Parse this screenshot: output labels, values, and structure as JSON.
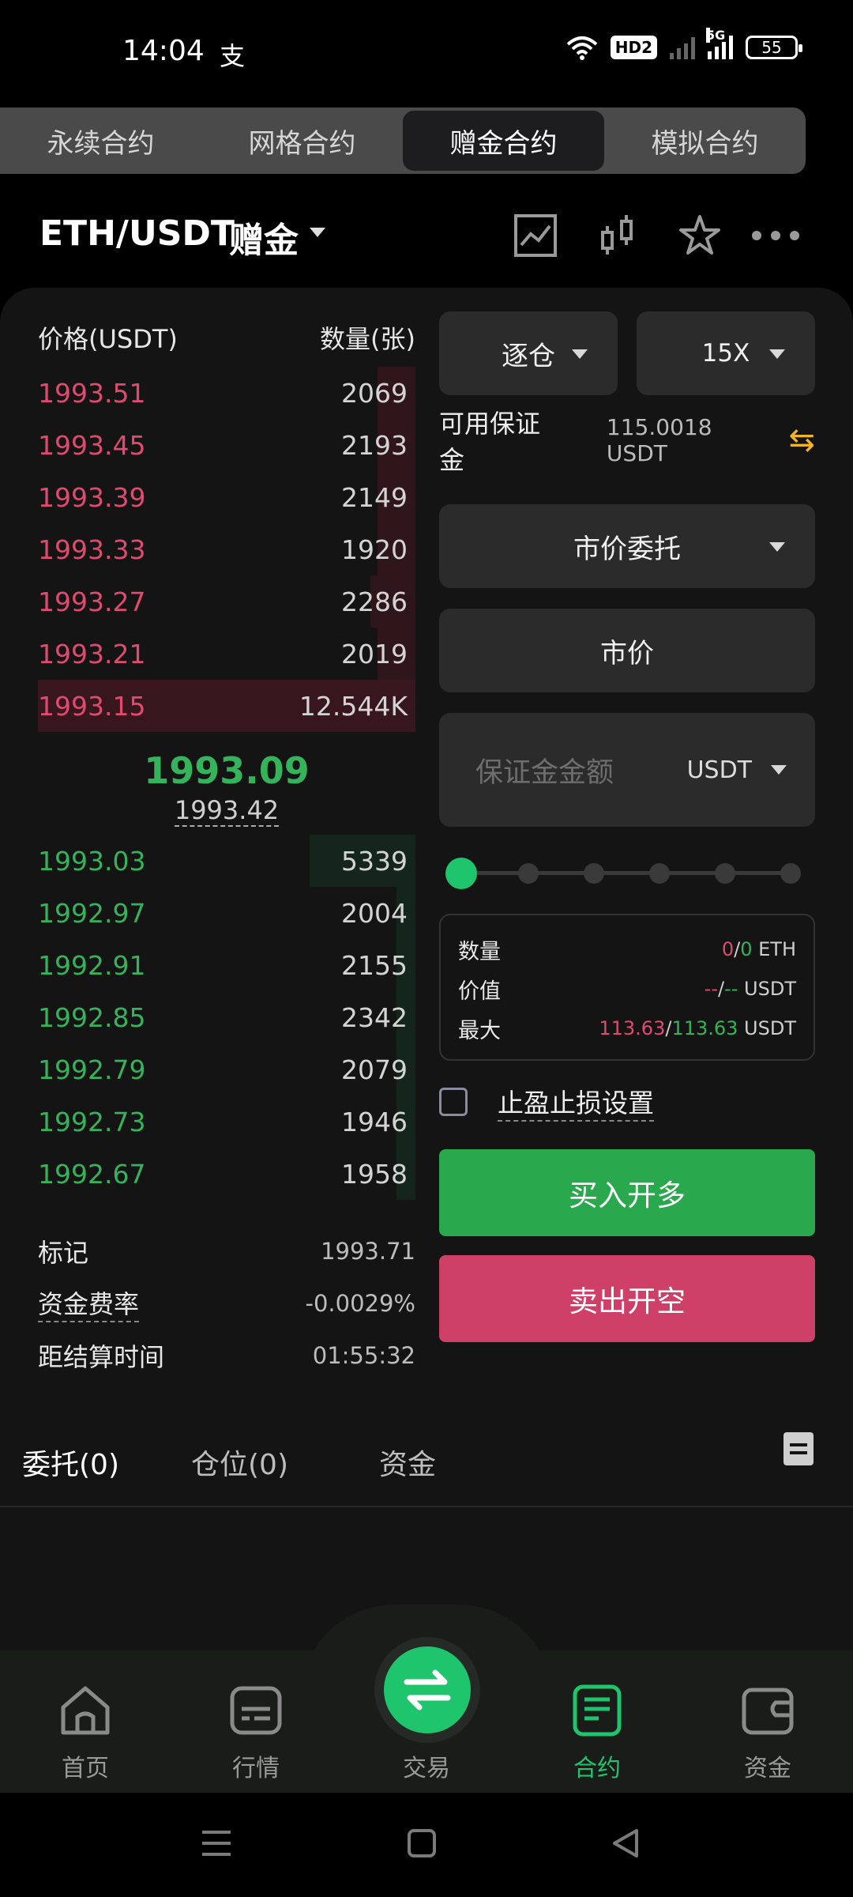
{
  "status_bar": {
    "time": "14:04",
    "app_glyph": "支",
    "hd": "HD2",
    "network": "5G",
    "battery": "55"
  },
  "top_tabs": [
    {
      "label": "永续合约",
      "active": false
    },
    {
      "label": "网格合约",
      "active": false
    },
    {
      "label": "赠金合约",
      "active": true
    },
    {
      "label": "模拟合约",
      "active": false
    }
  ],
  "header": {
    "pair": "ETH/USDT",
    "mode": "赠金",
    "icons": [
      "line-chart-icon",
      "candlestick-icon",
      "star-icon",
      "more-icon"
    ]
  },
  "order_book": {
    "price_header": "价格(USDT)",
    "qty_header": "数量(张)",
    "asks": [
      {
        "price": "1993.51",
        "qty": "2069",
        "depth": 0.1
      },
      {
        "price": "1993.45",
        "qty": "2193",
        "depth": 0.1
      },
      {
        "price": "1993.39",
        "qty": "2149",
        "depth": 0.1
      },
      {
        "price": "1993.33",
        "qty": "1920",
        "depth": 0.1
      },
      {
        "price": "1993.27",
        "qty": "2286",
        "depth": 0.12
      },
      {
        "price": "1993.21",
        "qty": "2019",
        "depth": 0.1
      },
      {
        "price": "1993.15",
        "qty": "12.544K",
        "depth": 1.0
      }
    ],
    "last_price": "1993.09",
    "index_price": "1993.42",
    "bids": [
      {
        "price": "1993.03",
        "qty": "5339",
        "depth": 0.28
      },
      {
        "price": "1992.97",
        "qty": "2004",
        "depth": 0.05
      },
      {
        "price": "1992.91",
        "qty": "2155",
        "depth": 0.05
      },
      {
        "price": "1992.85",
        "qty": "2342",
        "depth": 0.05
      },
      {
        "price": "1992.79",
        "qty": "2079",
        "depth": 0.05
      },
      {
        "price": "1992.73",
        "qty": "1946",
        "depth": 0.05
      },
      {
        "price": "1992.67",
        "qty": "1958",
        "depth": 0.05
      }
    ]
  },
  "stats": {
    "mark_label": "标记",
    "mark_value": "1993.71",
    "funding_label": "资金费率",
    "funding_value": "-0.0029%",
    "settle_label": "距结算时间",
    "settle_value": "01:55:32"
  },
  "controls": {
    "margin_mode": "逐仓",
    "leverage": "15X",
    "available_label": "可用保证金",
    "available_value": "115.0018 USDT",
    "order_type": "市价委托",
    "price_mode": "市价",
    "amount_placeholder": "保证金金额",
    "amount_unit": "USDT",
    "slider_level": 0,
    "info": {
      "qty_label": "数量",
      "qty_a": "0",
      "qty_sep": "/",
      "qty_b": "0",
      "qty_unit": " ETH",
      "value_label": "价值",
      "value_a": "--",
      "value_sep": "/",
      "value_b": "--",
      "value_unit": " USDT",
      "max_label": "最大",
      "max_a": "113.63",
      "max_sep": "/",
      "max_b": "113.63",
      "max_unit": " USDT"
    },
    "tpsl_label": "止盈止损设置",
    "buy_label": "买入开多",
    "sell_label": "卖出开空"
  },
  "sub_tabs": {
    "orders": "委托(0)",
    "positions": "仓位(0)",
    "funds": "资金"
  },
  "bottom_nav": {
    "home": "首页",
    "market": "行情",
    "trade": "交易",
    "contract": "合约",
    "assets": "资金"
  },
  "colors": {
    "accent_green": "#1fc56c",
    "buy_green": "#29a84d",
    "sell_red": "#ce4068",
    "ask_red": "#e04a6e",
    "bid_green": "#34b35a",
    "swap_yellow": "#f0b429"
  }
}
